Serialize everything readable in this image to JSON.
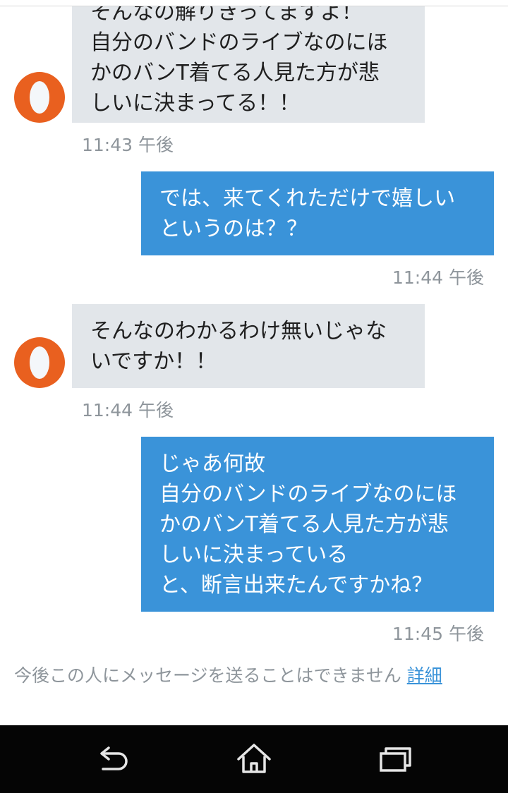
{
  "messages": [
    {
      "direction": "incoming",
      "text": "そんなの解りきってますよ！\n自分のバンドのライブなのにほ\nかのバンT着てる人見た方が悲\nしいに決まってる！！",
      "time": "11:43 午後"
    },
    {
      "direction": "outgoing",
      "text": "では、来てくれただけで嬉しい\nというのは？？",
      "time": "11:44 午後"
    },
    {
      "direction": "incoming",
      "text": "そんなのわかるわけ無いじゃな\nいですか！！",
      "time": "11:44 午後"
    },
    {
      "direction": "outgoing",
      "text": "じゃあ何故\n自分のバンドのライブなのにほ\nかのバンT着てる人見た方が悲\nしいに決まっている\nと、断言出来たんですかね？",
      "time": "11:45 午後"
    }
  ],
  "notice": {
    "text": "今後この人にメッセージを送ることはできません",
    "link": "詳細"
  },
  "navbar": {
    "icons": [
      "back-icon",
      "home-icon",
      "recent-apps-icon"
    ]
  },
  "colors": {
    "incoming_bubble": "#e2e6ea",
    "outgoing_bubble": "#3a93d9",
    "avatar": "#e9601f",
    "timestamp": "#8e959b",
    "navbar": "#050505"
  }
}
